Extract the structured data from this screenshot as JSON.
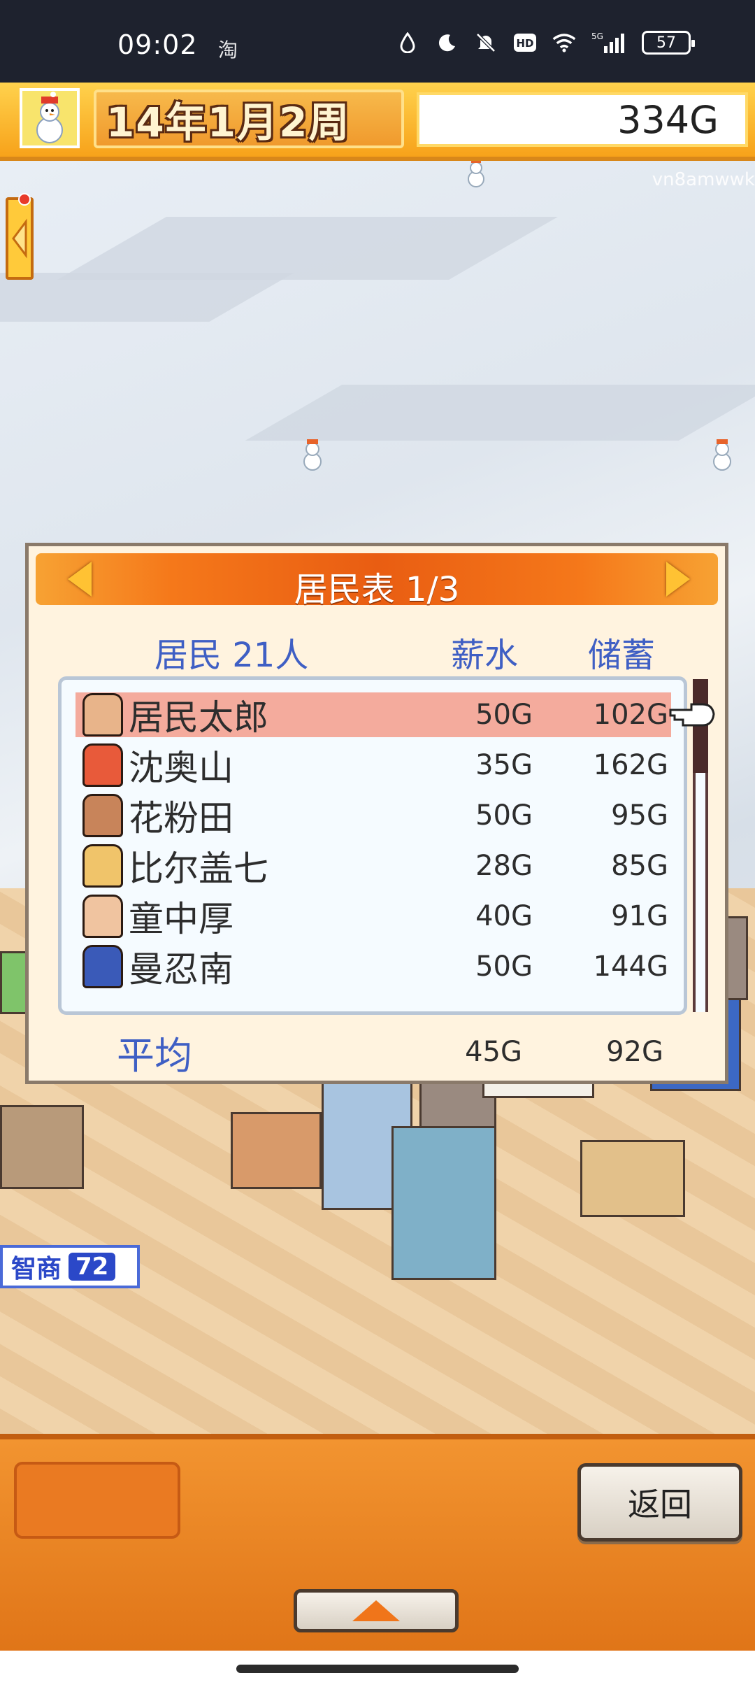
{
  "status_bar": {
    "time": "09:02",
    "app_label": "淘",
    "icons": [
      "water-drop-icon",
      "moon-icon",
      "bell-off-icon",
      "hd-icon",
      "wifi-icon",
      "signal-5g-icon"
    ],
    "battery": "57"
  },
  "top_bar": {
    "season_icon": "snowman-icon",
    "date": "14年1月2周",
    "money": "334G"
  },
  "world": {
    "watermark": "vn8amwwk",
    "wisdom_label": "智商",
    "wisdom_value": "72"
  },
  "residents_panel": {
    "title": "居民表 1/3",
    "header_residents": "居民 21人",
    "header_salary": "薪水",
    "header_savings": "储蓄",
    "rows": [
      {
        "name": "居民太郎",
        "salary": "50G",
        "savings": "102G",
        "selected": true
      },
      {
        "name": "沈奥山",
        "salary": "35G",
        "savings": "162G",
        "selected": false
      },
      {
        "name": "花粉田",
        "salary": "50G",
        "savings": "95G",
        "selected": false
      },
      {
        "name": "比尔盖七",
        "salary": "28G",
        "savings": "85G",
        "selected": false
      },
      {
        "name": "童中厚",
        "salary": "40G",
        "savings": "91G",
        "selected": false
      },
      {
        "name": "曼忍南",
        "salary": "50G",
        "savings": "144G",
        "selected": false
      }
    ],
    "average_label": "平均",
    "average_salary": "45G",
    "average_savings": "92G"
  },
  "bottom_bar": {
    "back_label": "返回"
  },
  "colors": {
    "header_orange": "#e95d12",
    "label_blue": "#3f5fc4",
    "selected_row": "#f4ab9d",
    "bottom_orange": "#e07518"
  }
}
